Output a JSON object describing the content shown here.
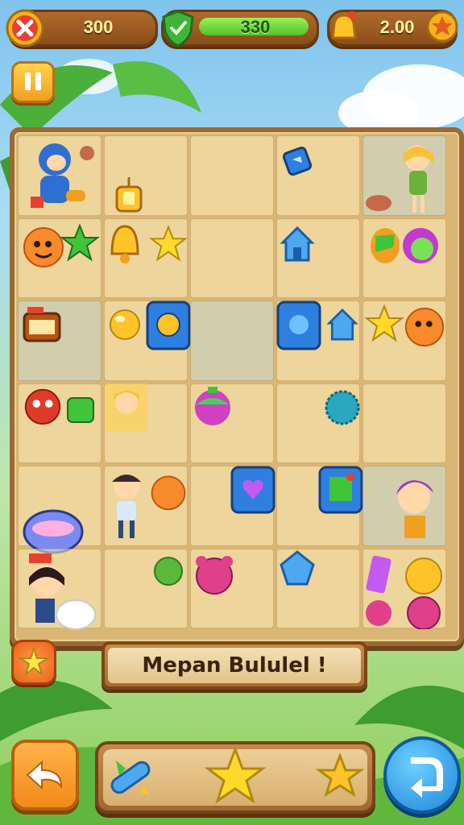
{
  "hud": {
    "lives": "300",
    "shield": "330",
    "coins": "2.00"
  },
  "board": {
    "rows": 6,
    "cols": 5
  },
  "banner_text": "Mepan Bululel !"
}
